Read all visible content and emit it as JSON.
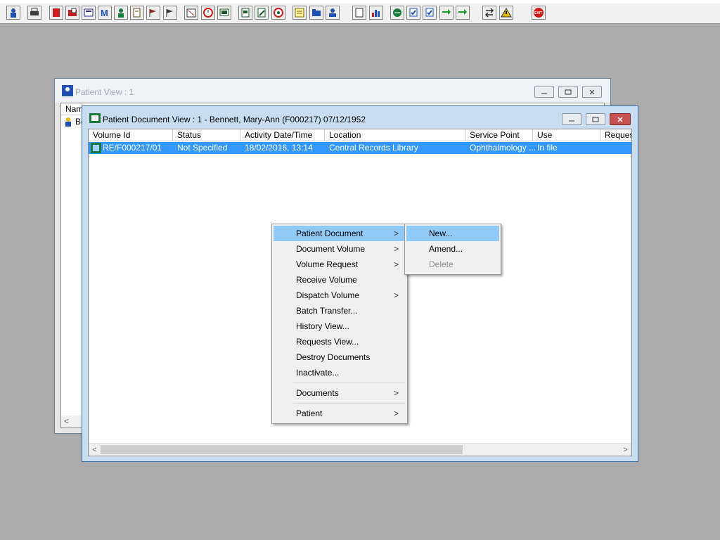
{
  "toolbar": {
    "buttons": [
      {
        "icon": "person-find-icon",
        "color": "#1f4fb0"
      },
      {
        "icon": "printer-icon",
        "color": "#3a3a3a"
      },
      {
        "icon": "red-book-icon",
        "color": "#c81e1e"
      },
      {
        "icon": "open-book-icon",
        "color": "#c81e1e"
      },
      {
        "icon": "monitor-doc-icon",
        "color": "#2a2a8a"
      },
      {
        "icon": "letter-m-icon",
        "color": "#1f4fb0"
      },
      {
        "icon": "doctor-icon",
        "color": "#1a7a3a"
      },
      {
        "icon": "notepad-edit-icon",
        "color": "#6a4a1a"
      },
      {
        "icon": "flag-pen-icon",
        "color": "#8a2a2a"
      },
      {
        "icon": "flag-pen-2-icon",
        "color": "#3a3a3a"
      },
      {
        "icon": "calendar-cross-icon",
        "color": "#3a3a3a"
      },
      {
        "icon": "clock-icon",
        "color": "#c81e1e"
      },
      {
        "icon": "screen-icon",
        "color": "#1a5a2a"
      },
      {
        "icon": "notes-icon",
        "color": "#1a5a2a"
      },
      {
        "icon": "notes-edit-icon",
        "color": "#1a5a2a"
      },
      {
        "icon": "globe-disc-icon",
        "color": "#c81e1e"
      },
      {
        "icon": "list-note-icon",
        "color": "#8a6a00"
      },
      {
        "icon": "folder-stack-icon",
        "color": "#1f4fb0"
      },
      {
        "icon": "person-stack-icon",
        "color": "#1f4fb0"
      },
      {
        "icon": "blank-page-icon",
        "color": "#3a3a3a"
      },
      {
        "icon": "bar-chart-icon",
        "color": "#1f4fb0"
      },
      {
        "icon": "globe-arrows-icon",
        "color": "#1a7a3a"
      },
      {
        "icon": "file-check-icon",
        "color": "#1f4fb0"
      },
      {
        "icon": "file-check-2-icon",
        "color": "#1f4fb0"
      },
      {
        "icon": "green-arrows-icon",
        "color": "#1a9a2a"
      },
      {
        "icon": "green-arrows-2-icon",
        "color": "#1a9a2a"
      },
      {
        "icon": "swap-arrows-icon",
        "color": "#2a2a2a"
      },
      {
        "icon": "warning-icon",
        "color": "#e6b800"
      },
      {
        "icon": "exit-icon",
        "color": "#d01818"
      }
    ]
  },
  "back_window": {
    "title": "Patient View : 1",
    "col_first": "Nam",
    "row_first": "Be"
  },
  "front_window": {
    "title": "Patient Document View : 1 - Bennett, Mary-Ann (F000217) 07/12/1952",
    "columns": [
      "Volume Id",
      "Status",
      "Activity Date/Time",
      "Location",
      "Service Point",
      "Use",
      "Reques"
    ],
    "row": {
      "volume_id": "RE/F000217/01",
      "status": "Not Specified",
      "activity": "18/02/2016, 13:14",
      "location": "Central Records Library",
      "service_point": "Ophthalmology ...",
      "use": "In file"
    }
  },
  "context_menu": {
    "items": [
      {
        "label": "Patient Document",
        "submenu": true
      },
      {
        "label": "Document Volume",
        "submenu": true
      },
      {
        "label": "Volume Request",
        "submenu": true
      },
      {
        "label": "Receive Volume",
        "submenu": false
      },
      {
        "label": "Dispatch Volume",
        "submenu": true
      },
      {
        "label": "Batch Transfer...",
        "submenu": false
      },
      {
        "label": "History View...",
        "submenu": false
      },
      {
        "label": "Requests View...",
        "submenu": false
      },
      {
        "label": "Destroy Documents",
        "submenu": false
      },
      {
        "label": "Inactivate...",
        "submenu": false
      },
      {
        "label": "Documents",
        "submenu": true
      },
      {
        "label": "Patient",
        "submenu": true
      }
    ],
    "arrow": ">"
  },
  "submenu": {
    "items": [
      {
        "label": "New..."
      },
      {
        "label": "Amend..."
      },
      {
        "label": "Delete",
        "disabled": true
      }
    ]
  }
}
